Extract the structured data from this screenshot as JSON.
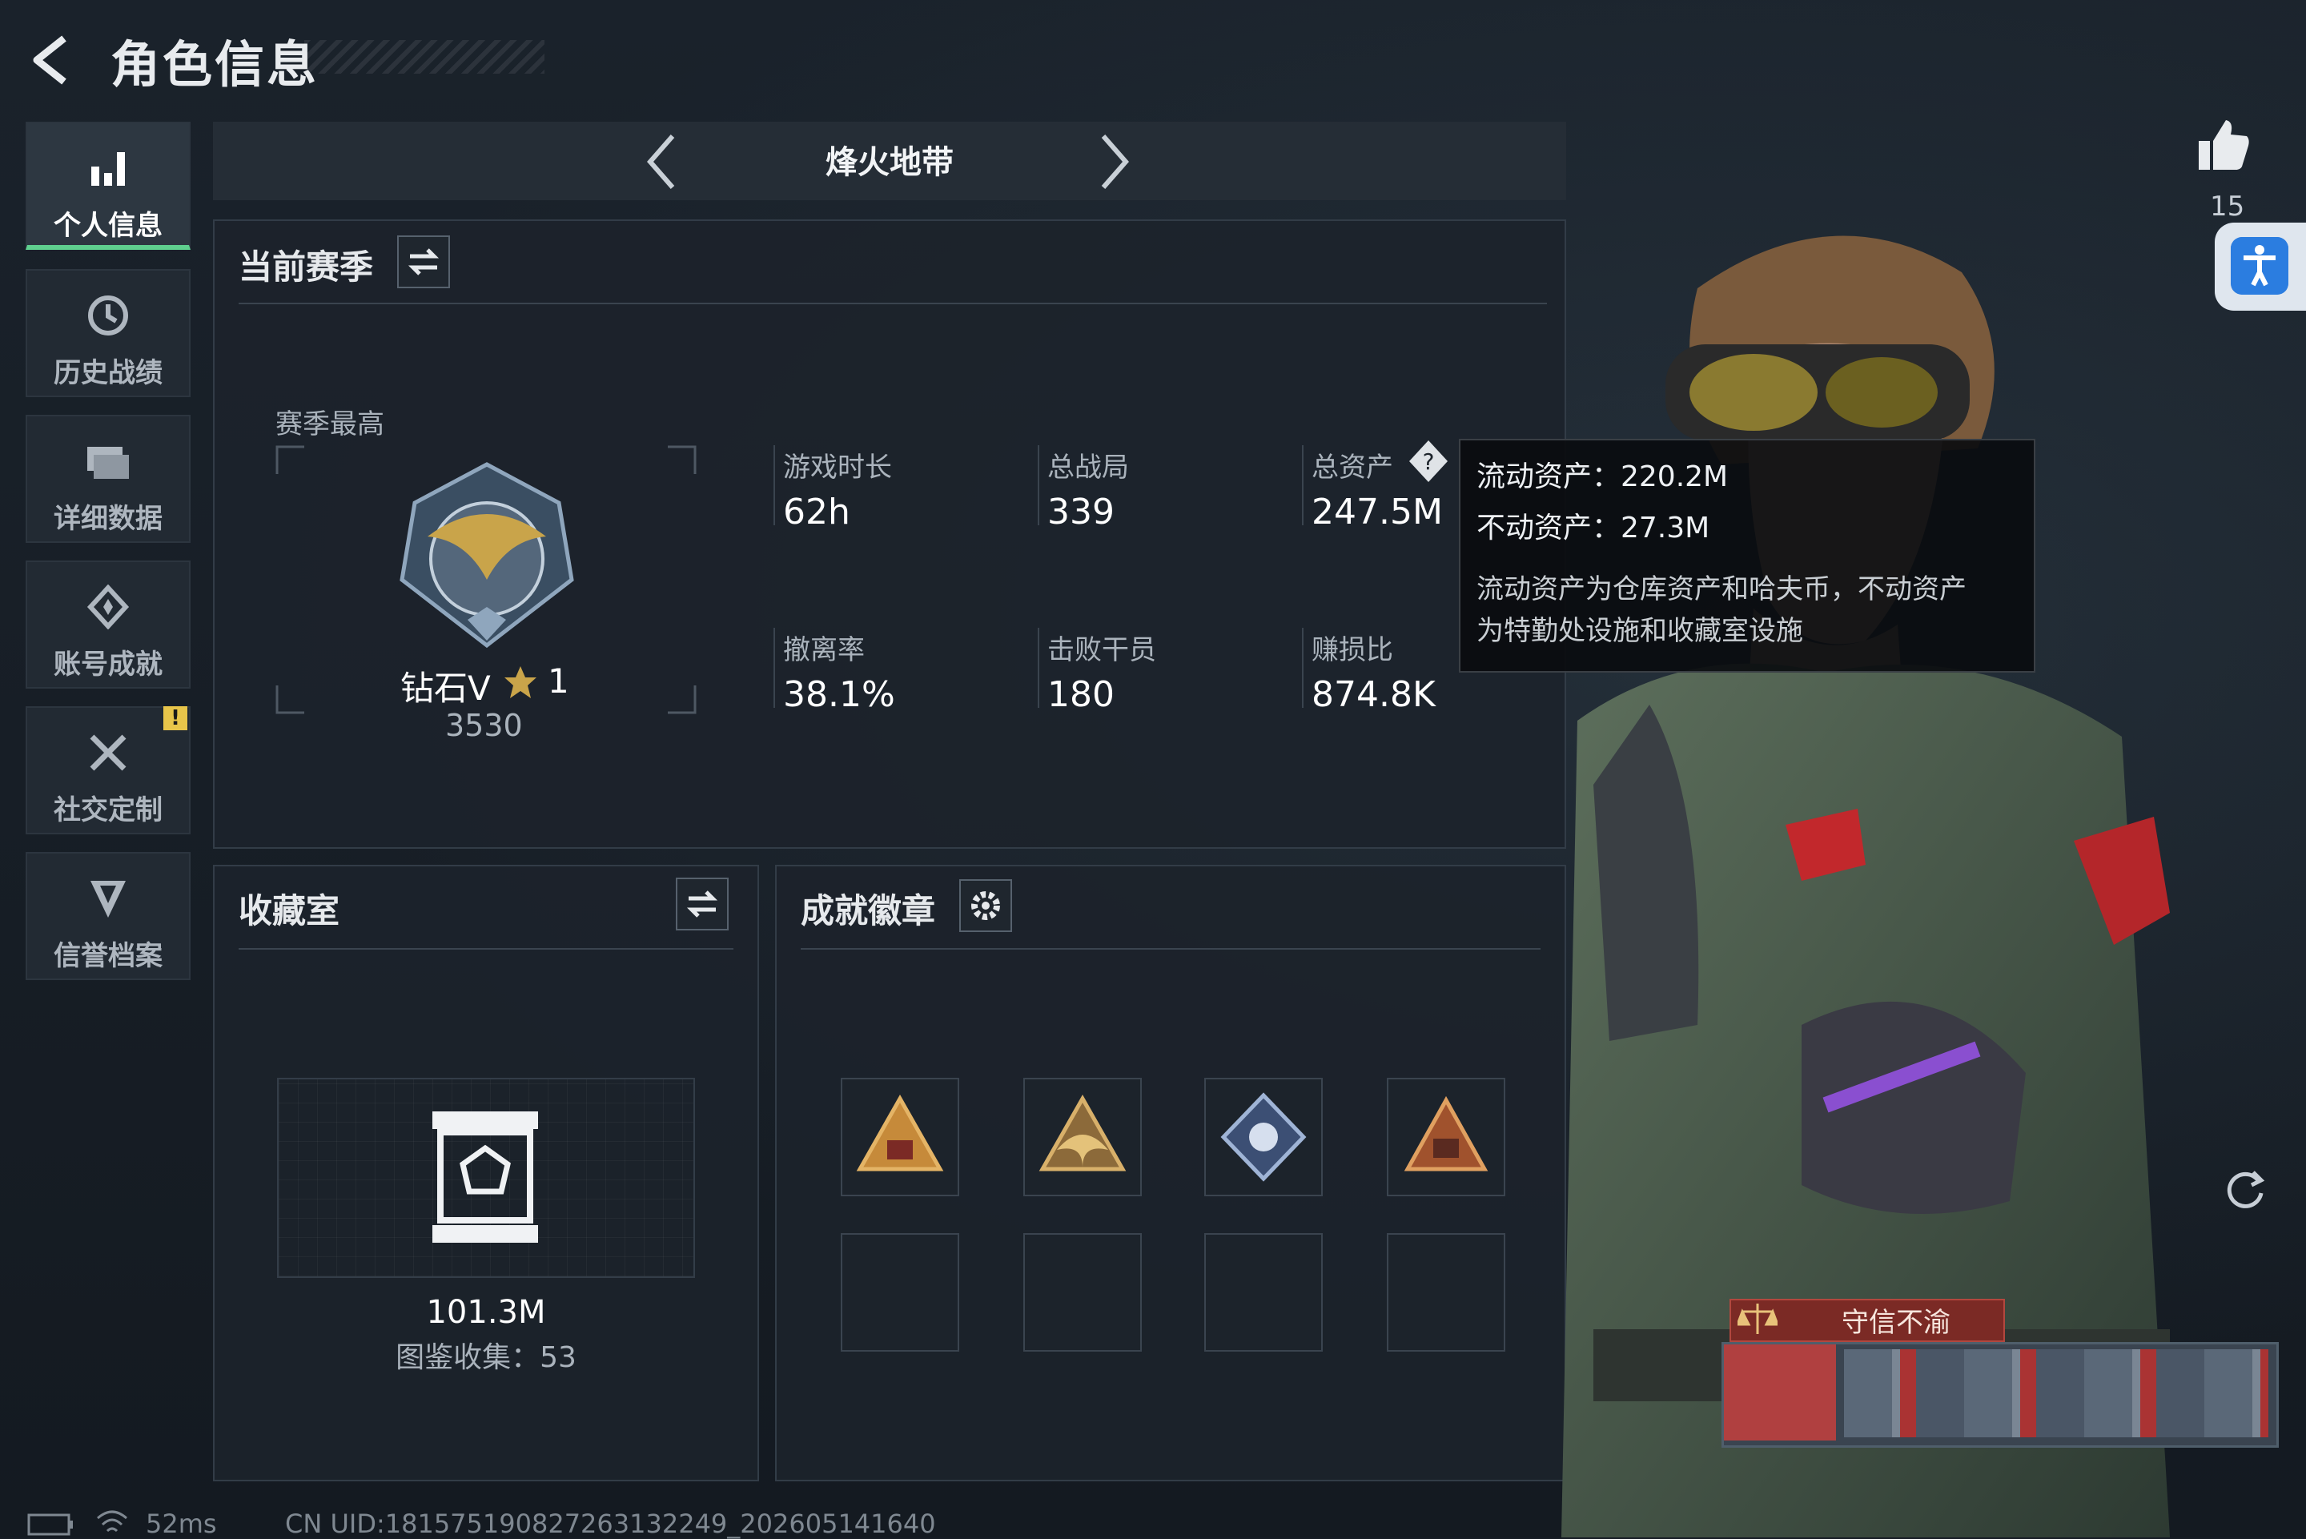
{
  "header": {
    "title": "角色信息"
  },
  "nav": [
    {
      "label": "个人信息",
      "icon": "bar-chart-icon",
      "active": true
    },
    {
      "label": "历史战绩",
      "icon": "history-icon",
      "active": false
    },
    {
      "label": "详细数据",
      "icon": "folder-icon",
      "active": false
    },
    {
      "label": "账号成就",
      "icon": "achievement-icon",
      "active": false
    },
    {
      "label": "社交定制",
      "icon": "tools-icon",
      "active": false
    },
    {
      "label": "信誉档案",
      "icon": "shield-icon",
      "active": false
    }
  ],
  "nav_warning": "!",
  "mode": {
    "label": "烽火地带"
  },
  "season": {
    "title": "当前赛季",
    "best_label": "赛季最高",
    "rank_name": "钻石V",
    "rank_stars": "1",
    "rank_points": "3530",
    "stats": [
      {
        "label": "游戏时长",
        "value": "62h"
      },
      {
        "label": "总战局",
        "value": "339"
      },
      {
        "label": "总资产",
        "value": "247.5M"
      },
      {
        "label": "撤离率",
        "value": "38.1%"
      },
      {
        "label": "击败干员",
        "value": "180"
      },
      {
        "label": "赚损比",
        "value": "874.8K"
      }
    ]
  },
  "tooltip": {
    "liquid": "流动资产：220.2M",
    "fixed": "不动资产：27.3M",
    "desc_line1": "流动资产为仓库资产和哈夫币，不动资产",
    "desc_line2": "为特勤处设施和收藏室设施"
  },
  "collection": {
    "title": "收藏室",
    "value": "101.3M",
    "count_text": "图鉴收集：53"
  },
  "badges": {
    "title": "成就徽章",
    "items": [
      {
        "icon": "s8-badge-icon"
      },
      {
        "icon": "eagle-badge-icon"
      },
      {
        "icon": "diamond-badge-icon"
      },
      {
        "icon": "s5-badge-icon"
      }
    ]
  },
  "character": {
    "title_banner": "守信不渝",
    "likes": "15"
  },
  "status": {
    "ping": "52ms",
    "uid": "CN UID:1815751908272631322​49_202605141640"
  },
  "colors": {
    "accent_green": "#5fd08f",
    "warning": "#e8c54a",
    "access_blue": "#2b7de0"
  }
}
